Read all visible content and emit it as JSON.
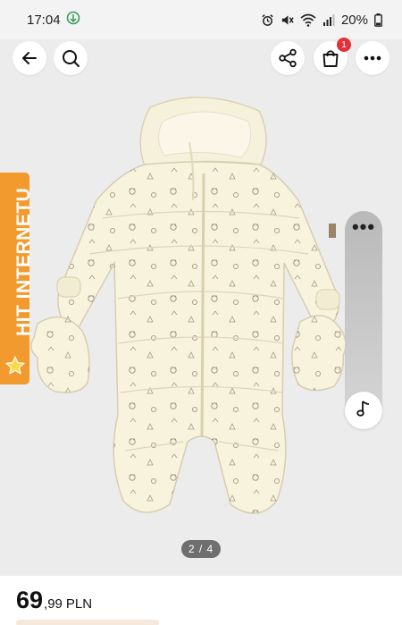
{
  "status_bar": {
    "time": "17:04",
    "battery": "20%",
    "icons": [
      "green-app-icon",
      "alarm-icon",
      "mute-icon",
      "wifi-icon",
      "signal-icon",
      "battery-icon"
    ]
  },
  "top_bar": {
    "buttons": [
      "back-arrow-icon",
      "search-icon",
      "share-icon",
      "cart-icon",
      "more-icon"
    ],
    "cart_count": "1"
  },
  "badge": {
    "text": "HIT INTERNETU",
    "icon": "star-icon",
    "color": "#f29a2e"
  },
  "side_widget": {
    "menu_icon": "more-dots-icon",
    "dots": "•••",
    "action_icon": "music-note-icon"
  },
  "gallery": {
    "counter": "2 / 4"
  },
  "price": {
    "integer": "69",
    "decimal": ",99",
    "currency": "PLN"
  },
  "colors": {
    "accent": "#f29a2e",
    "badge_red": "#e0323c",
    "background": "#efefef",
    "garment": "#f8f3dd"
  }
}
